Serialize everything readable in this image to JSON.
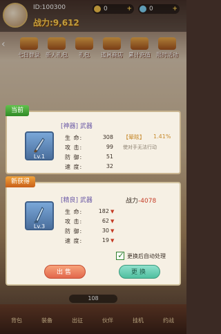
{
  "top": {
    "player_id": "ID:100300",
    "combat_power": "战力:9,612",
    "resources": [
      {
        "name": "coin-icon",
        "value": "0"
      },
      {
        "name": "gem-icon",
        "value": "0"
      }
    ]
  },
  "menu": {
    "items": [
      {
        "label": "七日登录"
      },
      {
        "label": "新人礼包"
      },
      {
        "label": "礼包"
      },
      {
        "label": "道具商店"
      },
      {
        "label": "累计充值"
      },
      {
        "label": "限时活动"
      }
    ]
  },
  "current_item": {
    "tag": "当前",
    "name": "[神器] 武器",
    "level": "Lv.1",
    "stats": [
      {
        "label": "生 命:",
        "value": "308"
      },
      {
        "label": "攻 击:",
        "value": "99"
      },
      {
        "label": "防 御:",
        "value": "51"
      },
      {
        "label": "速 度:",
        "value": "32"
      }
    ],
    "buff_title": "【晕眩】",
    "buff_value": "1.41%",
    "buff_desc": "使对手无法行动"
  },
  "new_item": {
    "tag": "新获得",
    "name": "[精良] 武器",
    "level": "Lv.3",
    "power_label": "战力",
    "power_value": "-4078",
    "stats": [
      {
        "label": "生 命:",
        "value": "182"
      },
      {
        "label": "攻 击:",
        "value": "62"
      },
      {
        "label": "防 御:",
        "value": "30"
      },
      {
        "label": "速 度:",
        "value": "19"
      }
    ],
    "auto_label": "更换后自动处理",
    "sell_label": "出售",
    "replace_label": "更换"
  },
  "bottom": {
    "badge": "108",
    "nav": [
      {
        "label": "背包"
      },
      {
        "label": "装备"
      },
      {
        "label": "出征"
      },
      {
        "label": "伙伴"
      },
      {
        "label": "挂机"
      },
      {
        "label": "约战"
      }
    ]
  },
  "colors": {
    "green_tag": "#2f8a26",
    "orange_tag": "#c8601a",
    "negative": "#c43a24",
    "buff": "#c78a2c"
  }
}
